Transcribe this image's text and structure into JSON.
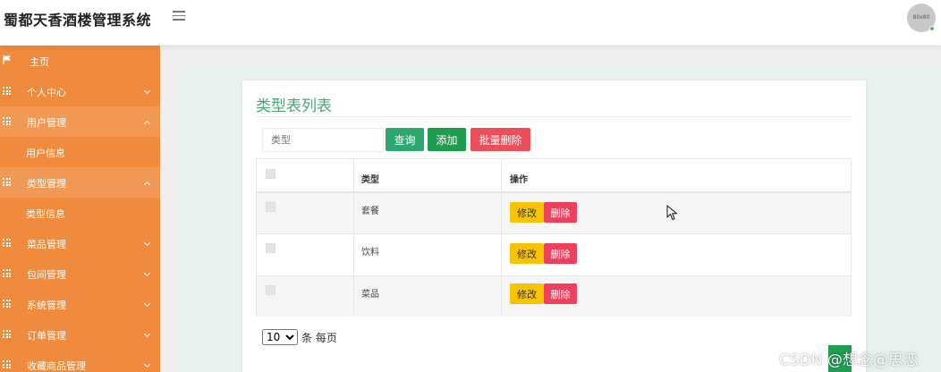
{
  "header": {
    "title": "蜀都天香酒楼管理系统",
    "avatar_text": "80x80"
  },
  "sidebar": {
    "items": [
      {
        "label": "主页"
      },
      {
        "label": "个人中心"
      },
      {
        "label": "用户管理"
      },
      {
        "label": "用户信息"
      },
      {
        "label": "类型管理"
      },
      {
        "label": "类型信息"
      },
      {
        "label": "菜品管理"
      },
      {
        "label": "包间管理"
      },
      {
        "label": "系统管理"
      },
      {
        "label": "订单管理"
      },
      {
        "label": "收藏商品管理"
      }
    ]
  },
  "main": {
    "title": "类型表列表",
    "search_placeholder": "类型",
    "buttons": {
      "query": "查询",
      "add": "添加",
      "batch_delete": "批量删除"
    },
    "table": {
      "headers": [
        "类型",
        "操作"
      ],
      "rows": [
        {
          "type": "套餐"
        },
        {
          "type": "饮料"
        },
        {
          "type": "菜品"
        }
      ],
      "edit_label": "修改",
      "delete_label": "删除"
    },
    "pagination": {
      "page_size": "10",
      "suffix": "条 每页"
    }
  },
  "watermark": "CSDN @想念@思恋",
  "colors": {
    "sidebar": "#f08a3c",
    "title_green": "#4aa56f",
    "query_button": "#2ca86f",
    "add_button": "#1e9d4e",
    "delete_button": "#ee4d5a",
    "edit_button": "#f7c302"
  }
}
